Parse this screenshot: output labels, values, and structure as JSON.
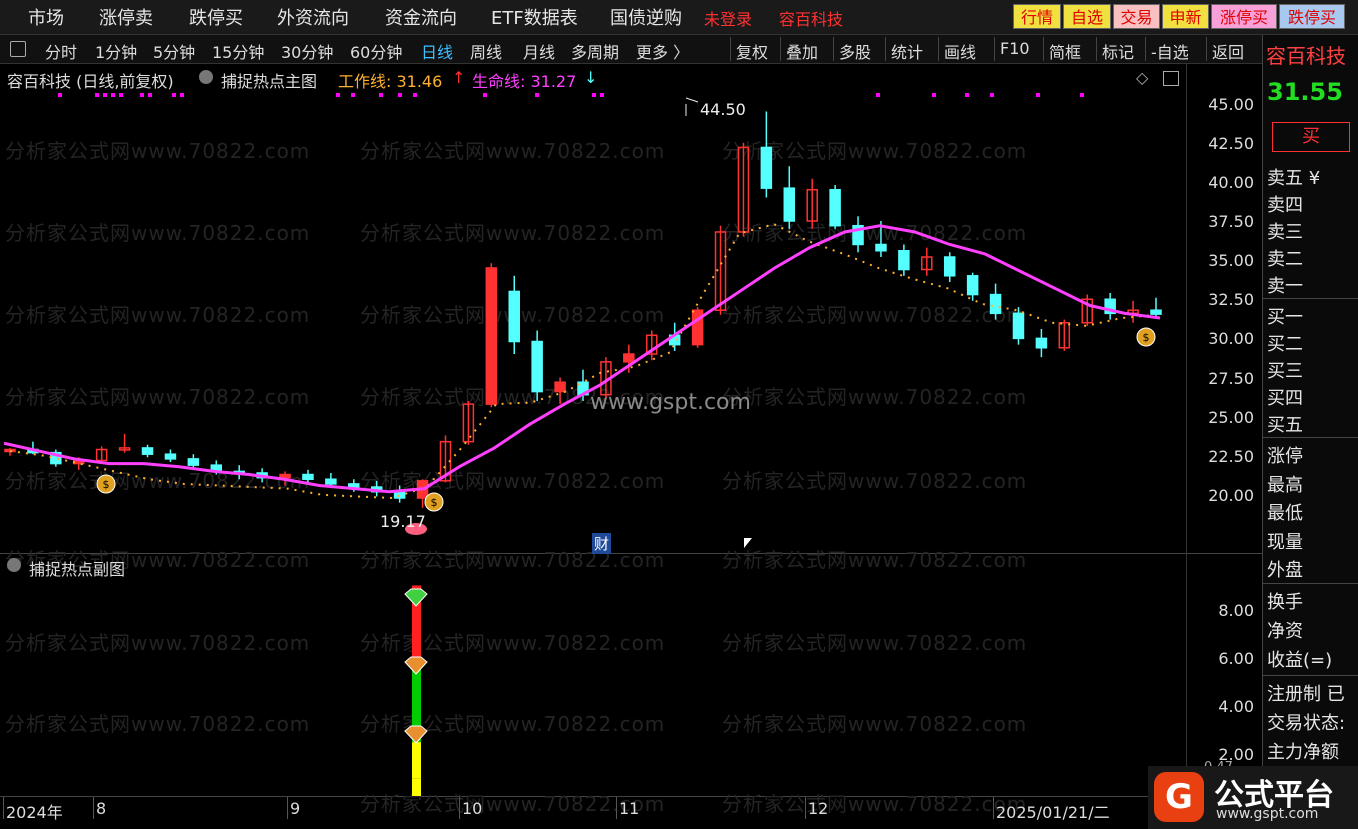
{
  "top_menu": {
    "items": [
      "市场",
      "涨停卖",
      "跌停买",
      "外资流向",
      "资金流向",
      "ETF数据表",
      "国债逆购"
    ],
    "login_text": "未登录",
    "stock_name": "容百科技",
    "right_buttons": [
      {
        "label": "行情",
        "bg": "#f0e040"
      },
      {
        "label": "自选",
        "bg": "#f0e040"
      },
      {
        "label": "交易",
        "bg": "#f8c0c0"
      },
      {
        "label": "申新",
        "bg": "#f0e040"
      },
      {
        "label": "涨停买",
        "bg": "#f8a0d8"
      },
      {
        "label": "跌停买",
        "bg": "#a8c8f0"
      }
    ]
  },
  "period_tabs": [
    "分时",
    "1分钟",
    "5分钟",
    "15分钟",
    "30分钟",
    "60分钟",
    "日线",
    "周线",
    "月线",
    "多周期",
    "更多 〉"
  ],
  "active_period": "日线",
  "tools": [
    "复权",
    "叠加",
    "多股",
    "统计",
    "画线",
    "F10",
    "简框",
    "标记",
    "-自选",
    "返回"
  ],
  "main_chart": {
    "title": "容百科技 (日线,前复权)",
    "indicator": "捕捉热点主图",
    "work_line_label": "工作线: 31.46",
    "life_line_label": "生命线: 31.27",
    "high_label": "44.50",
    "low_label": "19.17",
    "fin_marker": "财",
    "watermark_center": "www.gspt.com",
    "watermark_repeat": "分析家公式网www.70822.com",
    "colors": {
      "up": "#ff3232",
      "down": "#54ffff",
      "life": "#ff40ff",
      "work": "#ffb030",
      "dots": "#ff00ff"
    }
  },
  "sub_chart": {
    "indicator": "捕捉热点副图",
    "y_ticks": [
      "8.00",
      "6.00",
      "4.00",
      "2.00"
    ],
    "partial_value": "0.47"
  },
  "x_axis": [
    "2024年",
    "8",
    "9",
    "10",
    "11",
    "12",
    "2025/01/21/二"
  ],
  "right_panel": {
    "stock_name": "容百科技",
    "price": "31.55",
    "buy_button": "买",
    "sell_levels": [
      "卖五 ¥",
      "卖四",
      "卖三",
      "卖二",
      "卖一"
    ],
    "buy_levels": [
      "买一",
      "买二",
      "买三",
      "买四",
      "买五"
    ],
    "stats": [
      "涨停",
      "最高",
      "最低",
      "现量",
      "外盘"
    ],
    "stats2": [
      "换手",
      "净资",
      "收益(=)"
    ],
    "info": [
      "注册制 已",
      "交易状态:",
      "主力净额"
    ]
  },
  "logo": {
    "name": "公式平台",
    "url": "www.gspt.com"
  },
  "chart_data": {
    "type": "candlestick",
    "x_start_label": "2024年",
    "y_axis_ticks": [
      45.0,
      42.5,
      40.0,
      37.5,
      35.0,
      32.5,
      30.0,
      27.5,
      25.0,
      22.5,
      20.0
    ],
    "ylim": [
      17.5,
      46.0
    ],
    "series": [
      {
        "name": "生命线",
        "color": "#ff40ff",
        "values": [
          23.3,
          22.8,
          22.3,
          22.0,
          22.0,
          21.8,
          21.5,
          21.3,
          21.0,
          20.6,
          20.4,
          20.2,
          20.4,
          21.8,
          23.0,
          24.5,
          25.8,
          27.0,
          28.5,
          30.0,
          31.5,
          33.0,
          34.5,
          35.8,
          36.8,
          37.2,
          36.8,
          36.0,
          35.4,
          34.3,
          33.2,
          32.1,
          31.6,
          31.3
        ]
      },
      {
        "name": "工作线",
        "color": "#ffb030",
        "values": [
          22.8,
          22.5,
          22.0,
          21.5,
          21.0,
          20.7,
          20.6,
          20.5,
          20.4,
          20.0,
          19.9,
          19.8,
          20.5,
          23.0,
          25.8,
          25.9,
          26.6,
          27.8,
          28.2,
          29.1,
          33.0,
          36.7,
          37.3,
          36.2,
          35.4,
          34.5,
          33.8,
          33.2,
          32.2,
          31.8,
          31.0,
          30.8,
          31.3,
          31.5
        ]
      }
    ],
    "candles": [
      [
        22.8,
        23.0,
        22.5,
        22.9
      ],
      [
        22.9,
        23.4,
        22.6,
        22.7
      ],
      [
        22.7,
        22.9,
        21.8,
        22.0
      ],
      [
        22.0,
        22.4,
        21.6,
        22.2
      ],
      [
        22.2,
        23.1,
        22.0,
        22.9
      ],
      [
        22.9,
        23.9,
        22.7,
        23.0
      ],
      [
        23.0,
        23.2,
        22.4,
        22.6
      ],
      [
        22.6,
        22.9,
        22.1,
        22.3
      ],
      [
        22.3,
        22.6,
        21.7,
        21.9
      ],
      [
        21.9,
        22.2,
        21.3,
        21.5
      ],
      [
        21.5,
        21.9,
        21.0,
        21.4
      ],
      [
        21.4,
        21.7,
        20.8,
        21.1
      ],
      [
        21.1,
        21.5,
        20.6,
        21.3
      ],
      [
        21.3,
        21.6,
        20.8,
        21.0
      ],
      [
        21.0,
        21.4,
        20.5,
        20.7
      ],
      [
        20.7,
        21.0,
        20.2,
        20.5
      ],
      [
        20.5,
        20.9,
        19.9,
        20.2
      ],
      [
        20.2,
        20.6,
        19.5,
        19.8
      ],
      [
        19.8,
        21.0,
        19.17,
        20.9
      ],
      [
        20.9,
        23.8,
        20.8,
        23.4
      ],
      [
        23.4,
        26.0,
        23.2,
        25.8
      ],
      [
        25.8,
        34.8,
        25.6,
        34.5
      ],
      [
        33.0,
        34.0,
        29.0,
        29.8
      ],
      [
        29.8,
        30.5,
        26.0,
        26.6
      ],
      [
        26.6,
        27.5,
        25.8,
        27.2
      ],
      [
        27.2,
        28.0,
        26.0,
        26.4
      ],
      [
        26.4,
        28.8,
        26.2,
        28.5
      ],
      [
        28.5,
        29.6,
        27.8,
        29.0
      ],
      [
        29.0,
        30.5,
        28.6,
        30.2
      ],
      [
        30.2,
        31.0,
        29.2,
        29.6
      ],
      [
        29.6,
        32.0,
        29.4,
        31.8
      ],
      [
        31.8,
        37.2,
        31.5,
        36.8
      ],
      [
        36.8,
        42.5,
        36.5,
        42.2
      ],
      [
        42.2,
        44.5,
        39.0,
        39.6
      ],
      [
        39.6,
        41.0,
        37.0,
        37.5
      ],
      [
        37.5,
        40.2,
        37.0,
        39.5
      ],
      [
        39.5,
        39.8,
        37.0,
        37.2
      ],
      [
        37.2,
        37.8,
        35.5,
        36.0
      ],
      [
        36.0,
        37.5,
        35.2,
        35.6
      ],
      [
        35.6,
        36.0,
        34.0,
        34.4
      ],
      [
        34.4,
        35.8,
        34.0,
        35.2
      ],
      [
        35.2,
        35.5,
        33.6,
        34.0
      ],
      [
        34.0,
        34.2,
        32.4,
        32.8
      ],
      [
        32.8,
        33.5,
        31.2,
        31.6
      ],
      [
        31.6,
        32.0,
        29.6,
        30.0
      ],
      [
        30.0,
        30.6,
        28.8,
        29.4
      ],
      [
        29.4,
        31.2,
        29.2,
        31.0
      ],
      [
        31.0,
        32.8,
        30.8,
        32.5
      ],
      [
        32.5,
        32.9,
        31.2,
        31.6
      ],
      [
        31.6,
        32.4,
        31.0,
        31.8
      ],
      [
        31.8,
        32.6,
        31.4,
        31.55
      ]
    ],
    "marker_low": 19.17,
    "marker_high": 44.5,
    "sub_bars": [
      {
        "from": 0.0,
        "to": 1.0,
        "color": "#ffff00"
      },
      {
        "from": 1.0,
        "to": 2.5,
        "color": "#ffff00"
      },
      {
        "from": 2.5,
        "to": 6.0,
        "color": "#00cc00"
      },
      {
        "from": 6.0,
        "to": 9.0,
        "color": "#ff2020"
      }
    ],
    "sub_ylim": [
      0.47,
      9.6
    ]
  }
}
